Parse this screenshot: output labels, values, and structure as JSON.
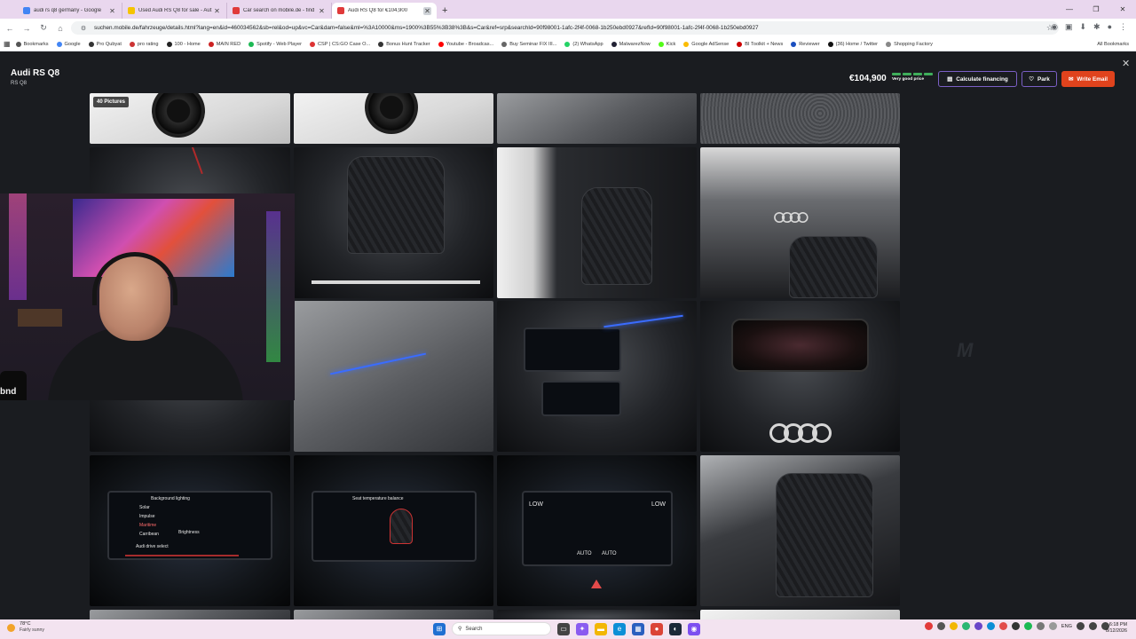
{
  "browser": {
    "tabs": [
      {
        "title": "audi rs q8 germany - Google",
        "favicon_color": "#4285f4",
        "active": false
      },
      {
        "title": "Used Audi RS Q8 for sale - Aut",
        "favicon_color": "#f5c400",
        "active": false
      },
      {
        "title": "Car search on mobile.de - find",
        "favicon_color": "#e03a3a",
        "active": false
      },
      {
        "title": "Audi RS Q8 for €104,900",
        "favicon_color": "#e03a3a",
        "active": true
      }
    ],
    "url": "suchen.mobile.de/fahrzeuge/details.html?lang=en&id=460034562&sb=rel&od=up&vc=Car&dam=false&ml=%3A10000&ms=1900%3B55%3B38%3B&s=Car&ref=srp&searchId=90f98001-1afc-2f4f-0068-1b250ebd0927&refId=90f98001-1afc-2f4f-0068-1b250ebd0927",
    "bookmarks": [
      {
        "label": "Bookmarks",
        "color": "#555"
      },
      {
        "label": "Google",
        "color": "#4285f4"
      },
      {
        "label": "Pro Qubyat",
        "color": "#333"
      },
      {
        "label": "pro rating",
        "color": "#c33"
      },
      {
        "label": "100 - Home",
        "color": "#222"
      },
      {
        "label": "MAIN RED",
        "color": "#c22"
      },
      {
        "label": "Spotify - Web Player",
        "color": "#1db954"
      },
      {
        "label": "CSP | CS:GO Case O...",
        "color": "#d33"
      },
      {
        "label": "Bonus Hunt Tracker",
        "color": "#333"
      },
      {
        "label": "Youtube - Broadcas...",
        "color": "#f00"
      },
      {
        "label": "Buy Seminar FIX III...",
        "color": "#666"
      },
      {
        "label": "(2) WhatsApp",
        "color": "#25d366"
      },
      {
        "label": "MalwarezNow",
        "color": "#223"
      },
      {
        "label": "Kick",
        "color": "#53fc18"
      },
      {
        "label": "Google AdSense",
        "color": "#fbbc04"
      },
      {
        "label": "BI Toolkit + News",
        "color": "#c00"
      },
      {
        "label": "Reviewer",
        "color": "#1a4fbf"
      },
      {
        "label": "(36) Home / Twitter",
        "color": "#111"
      },
      {
        "label": "Shopping Factory",
        "color": "#888"
      }
    ],
    "all_bookmarks": "All Bookmarks",
    "window_controls": [
      "—",
      "❐",
      "✕"
    ]
  },
  "listing": {
    "title": "Audi RS Q8",
    "subtitle": "RS Q8",
    "price": "€104,900",
    "price_rating": "Very good price",
    "rating_level": 4,
    "rating_max": 4,
    "btn_financing": "Calculate financing",
    "btn_park": "Park",
    "btn_email": "Write Email",
    "pictures_badge": "40 Pictures",
    "watermark": "M",
    "screen_texts": {
      "s1": [
        "Background lighting",
        "Solar",
        "Impulse",
        "Maritime",
        "Carribean",
        "Brightness",
        "Audi drive select"
      ],
      "s2": [
        "Seat temperature balance"
      ],
      "s3": [
        "LOW",
        "LOW",
        "AUTO",
        "AUTO"
      ]
    },
    "accent_colors": {
      "email": "#e0431d",
      "outline": "#7a5fc5",
      "rating": "#3fae5b"
    }
  },
  "webcam": {
    "mic_label": "bnd"
  },
  "taskbar": {
    "weather_temp": "78°C",
    "weather_desc": "Fairly sunny",
    "search_placeholder": "Search",
    "lang": "ENG",
    "time": "6:18 PM",
    "date": "8/12/2026"
  }
}
